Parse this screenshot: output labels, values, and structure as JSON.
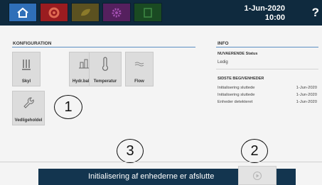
{
  "header": {
    "date": "1-Jun-2020",
    "time": "10:00",
    "help_label": "?",
    "tabs": [
      {
        "icon": "home-icon",
        "color": "#2f6fb8"
      },
      {
        "icon": "recirculation-icon",
        "color": "#b62025"
      },
      {
        "icon": "leaf-icon",
        "color": "#6e6020"
      },
      {
        "icon": "gear-icon",
        "color": "#6a2a73"
      },
      {
        "icon": "book-icon",
        "color": "#1f5a2a"
      }
    ]
  },
  "config": {
    "title": "KONFIGURATION",
    "buttons": [
      {
        "label": "Skyl",
        "icon": "flush-icon"
      },
      {
        "label": "Hydr.balan.",
        "icon": "hydraulic-balance-icon"
      },
      {
        "label": "Temperatur",
        "icon": "thermometer-icon"
      },
      {
        "label": "Flow",
        "icon": "flow-icon"
      },
      {
        "label": "Vedligeholdel",
        "icon": "wrench-icon"
      }
    ]
  },
  "info": {
    "title": "INFO",
    "status_heading": "NUVAERENDE Status",
    "status_value": "Ledig",
    "events_heading": "SIDSTE BEGIVENHEDER",
    "events": [
      {
        "text": "Initialisering sluttede",
        "date": "1-Jun-2020"
      },
      {
        "text": "Initialisering sluttede",
        "date": "1-Jun-2020"
      },
      {
        "text": "Enheder detekteret",
        "date": "1-Jun-2020"
      }
    ]
  },
  "callouts": [
    "1",
    "2",
    "3"
  ],
  "status_bar": {
    "message": "Initialisering af enhederne er afslutte"
  }
}
